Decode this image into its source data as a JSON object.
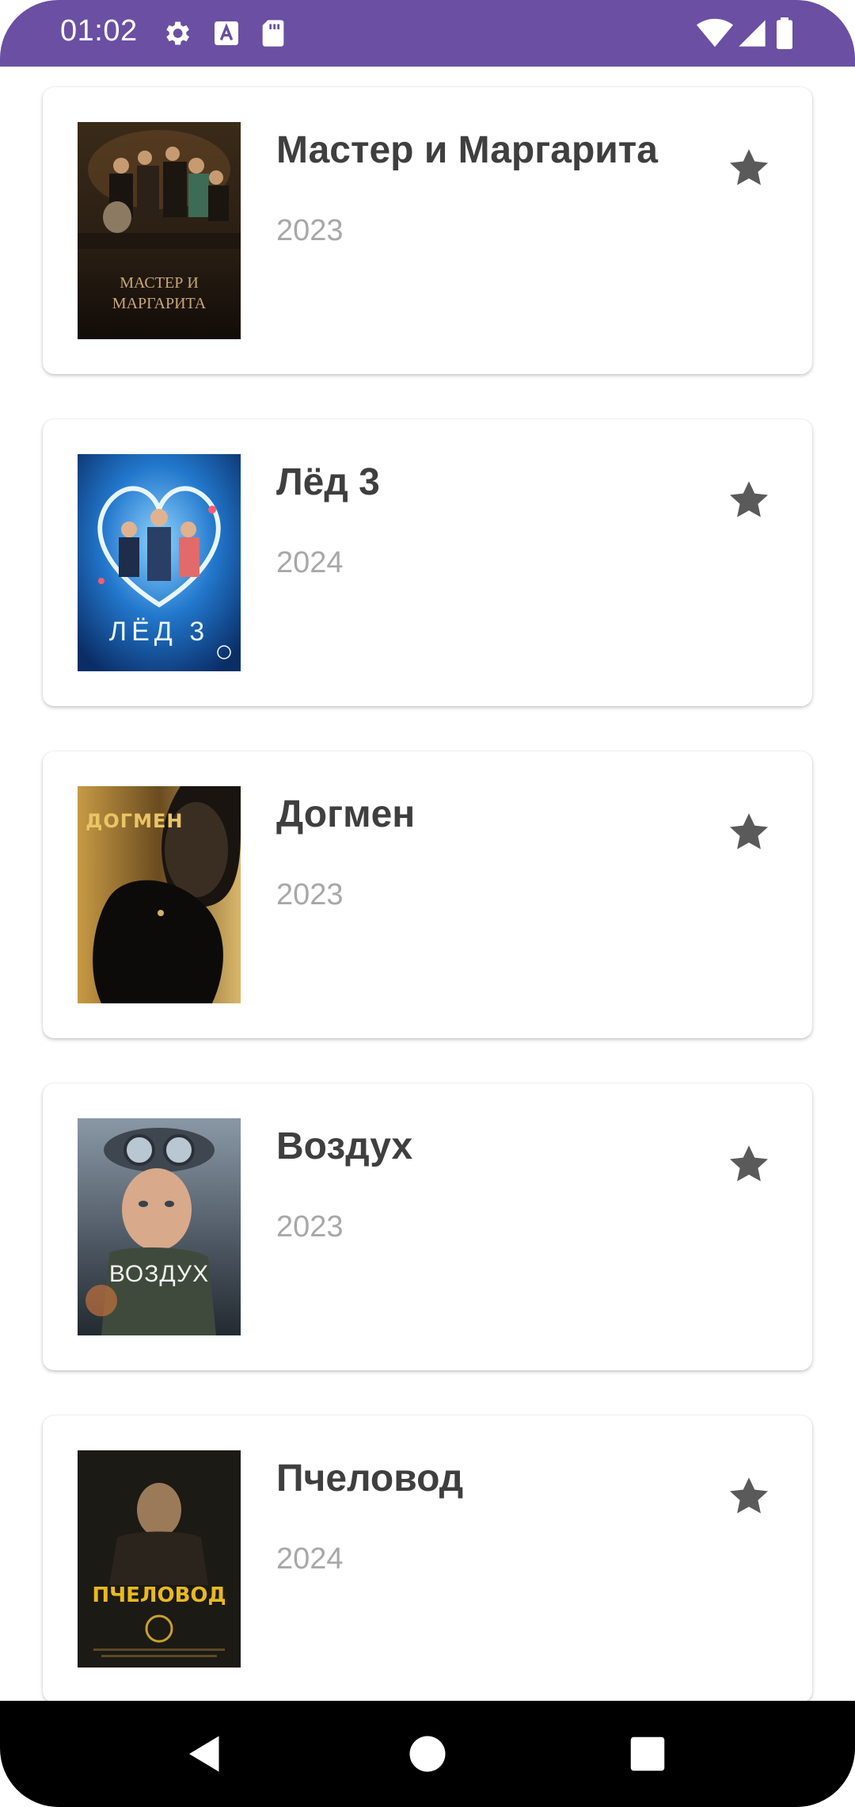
{
  "status_bar": {
    "time": "01:02",
    "icons": [
      "gear-icon",
      "a-badge-icon",
      "sd-card-icon",
      "wifi-icon",
      "signal-icon",
      "battery-icon"
    ],
    "background": "#6a4fa3"
  },
  "movies": [
    {
      "title": "Мастер и Маргарита",
      "year": "2023",
      "poster_text": "МАСТЕР И МАРГАРИТА"
    },
    {
      "title": "Лёд 3",
      "year": "2024",
      "poster_text": "ЛЁД 3"
    },
    {
      "title": "Догмен",
      "year": "2023",
      "poster_text": "ДОГМЕН"
    },
    {
      "title": "Воздух",
      "year": "2023",
      "poster_text": "ВОЗДУХ"
    },
    {
      "title": "Пчеловод",
      "year": "2024",
      "poster_text": "ПЧЕЛОВОД"
    }
  ],
  "colors": {
    "title": "#3f3f3f",
    "year": "#a8a8a8",
    "star": "#5a5a5a"
  },
  "nav_bar": {
    "buttons": [
      "back-icon",
      "home-icon",
      "recents-icon"
    ]
  }
}
